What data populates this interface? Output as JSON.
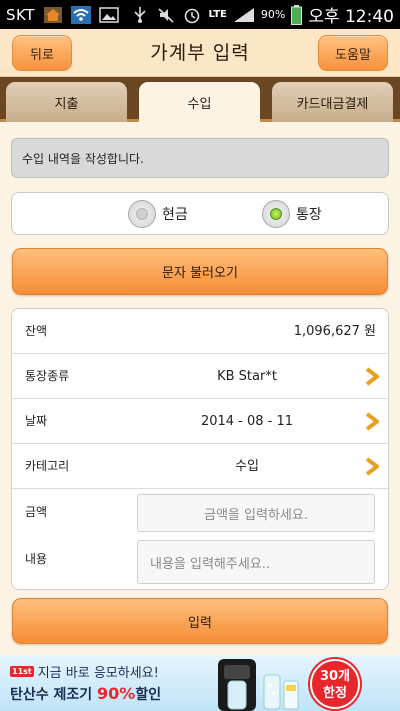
{
  "status_bar": {
    "carrier": "SKT",
    "network": "LTE",
    "battery": "90%",
    "time": "오후 12:40",
    "icons": [
      "home-icon",
      "wifi-icon",
      "image-icon",
      "usb-icon",
      "mute-icon",
      "alarm-icon",
      "lte-signal-icon",
      "battery-icon"
    ]
  },
  "header": {
    "back_label": "뒤로",
    "title": "가계부 입력",
    "help_label": "도움말"
  },
  "tabs": [
    {
      "label": "지출",
      "active": false
    },
    {
      "label": "수입",
      "active": true
    },
    {
      "label": "카드대금결제",
      "active": false
    }
  ],
  "notice": "수입 내역을 작성합니다.",
  "payment_type": {
    "options": [
      {
        "label": "현금",
        "selected": false
      },
      {
        "label": "통장",
        "selected": true
      }
    ]
  },
  "sms_button_label": "문자 불러오기",
  "form": {
    "balance": {
      "label": "잔액",
      "value": "1,096,627 원"
    },
    "account": {
      "label": "통장종류",
      "value": "KB Star*t"
    },
    "date": {
      "label": "날짜",
      "value": "2014 - 08 - 11"
    },
    "category": {
      "label": "카테고리",
      "value": "수입"
    },
    "amount": {
      "label": "금액",
      "placeholder": "금액을 입력하세요."
    },
    "memo": {
      "label": "내용",
      "placeholder": "내용을 입력해주세요.."
    }
  },
  "submit_label": "입력",
  "ad": {
    "badge_small": "11st",
    "line1": "지금 바로 응모하세요!",
    "line2_prefix": "탄산수 제조기 ",
    "line2_highlight": "90%",
    "line2_suffix": "할인",
    "badge_line1": "30개",
    "badge_line2": "한정"
  },
  "colors": {
    "header_bg": "#fde6c6",
    "tab_bar_bg": "#6a4622",
    "button_orange": "#f58d35",
    "chevron": "#e8a020",
    "radio_selected": "#6cba1a"
  }
}
